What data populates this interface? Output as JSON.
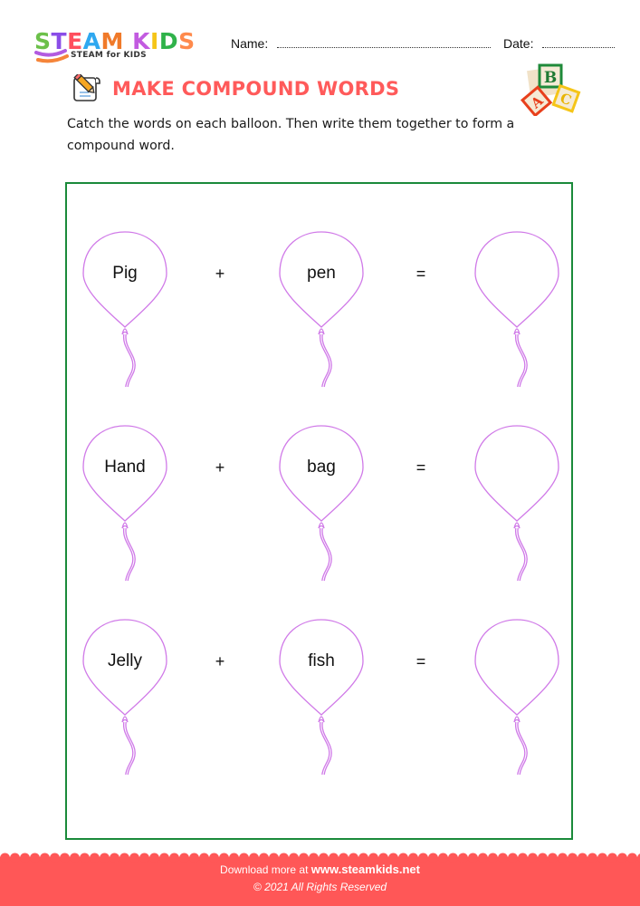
{
  "header": {
    "logo": {
      "letters": [
        {
          "char": "S",
          "color": "#6cc04a"
        },
        {
          "char": "T",
          "color": "#8a4de8"
        },
        {
          "char": "E",
          "color": "#ff4f5e"
        },
        {
          "char": "A",
          "color": "#2fa8f0"
        },
        {
          "char": "M",
          "color": "#f07a2a"
        },
        {
          "char": " ",
          "color": "#ffffff"
        },
        {
          "char": "K",
          "color": "#c25be0"
        },
        {
          "char": "I",
          "color": "#f5c518"
        },
        {
          "char": "D",
          "color": "#2fb24a"
        },
        {
          "char": "S",
          "color": "#ff8a4c"
        }
      ],
      "tagline": "STEAM for KIDS"
    },
    "name_label": "Name:",
    "date_label": "Date:"
  },
  "worksheet": {
    "title": "MAKE COMPOUND WORDS",
    "title_color": "#ff5a5a",
    "title_icon": "pencil-paper-icon",
    "decoration_icon": "abc-blocks-icon",
    "blocks": [
      "B",
      "A",
      "C"
    ],
    "instructions": "Catch the words on each balloon. Then write them together to form a compound word.",
    "plus_symbol": "+",
    "equals_symbol": "=",
    "rows": [
      {
        "first": "Pig",
        "second": "pen",
        "answer": ""
      },
      {
        "first": "Hand",
        "second": "bag",
        "answer": ""
      },
      {
        "first": "Jelly",
        "second": "fish",
        "answer": ""
      }
    ],
    "balloon_color": "#d07ae8",
    "frame_color": "#1a8a3a"
  },
  "footer": {
    "download_prefix": "Download more at",
    "website": "www.steamkids.net",
    "copyright": "© 2021 All Rights Reserved",
    "background_color": "#ff5757"
  }
}
